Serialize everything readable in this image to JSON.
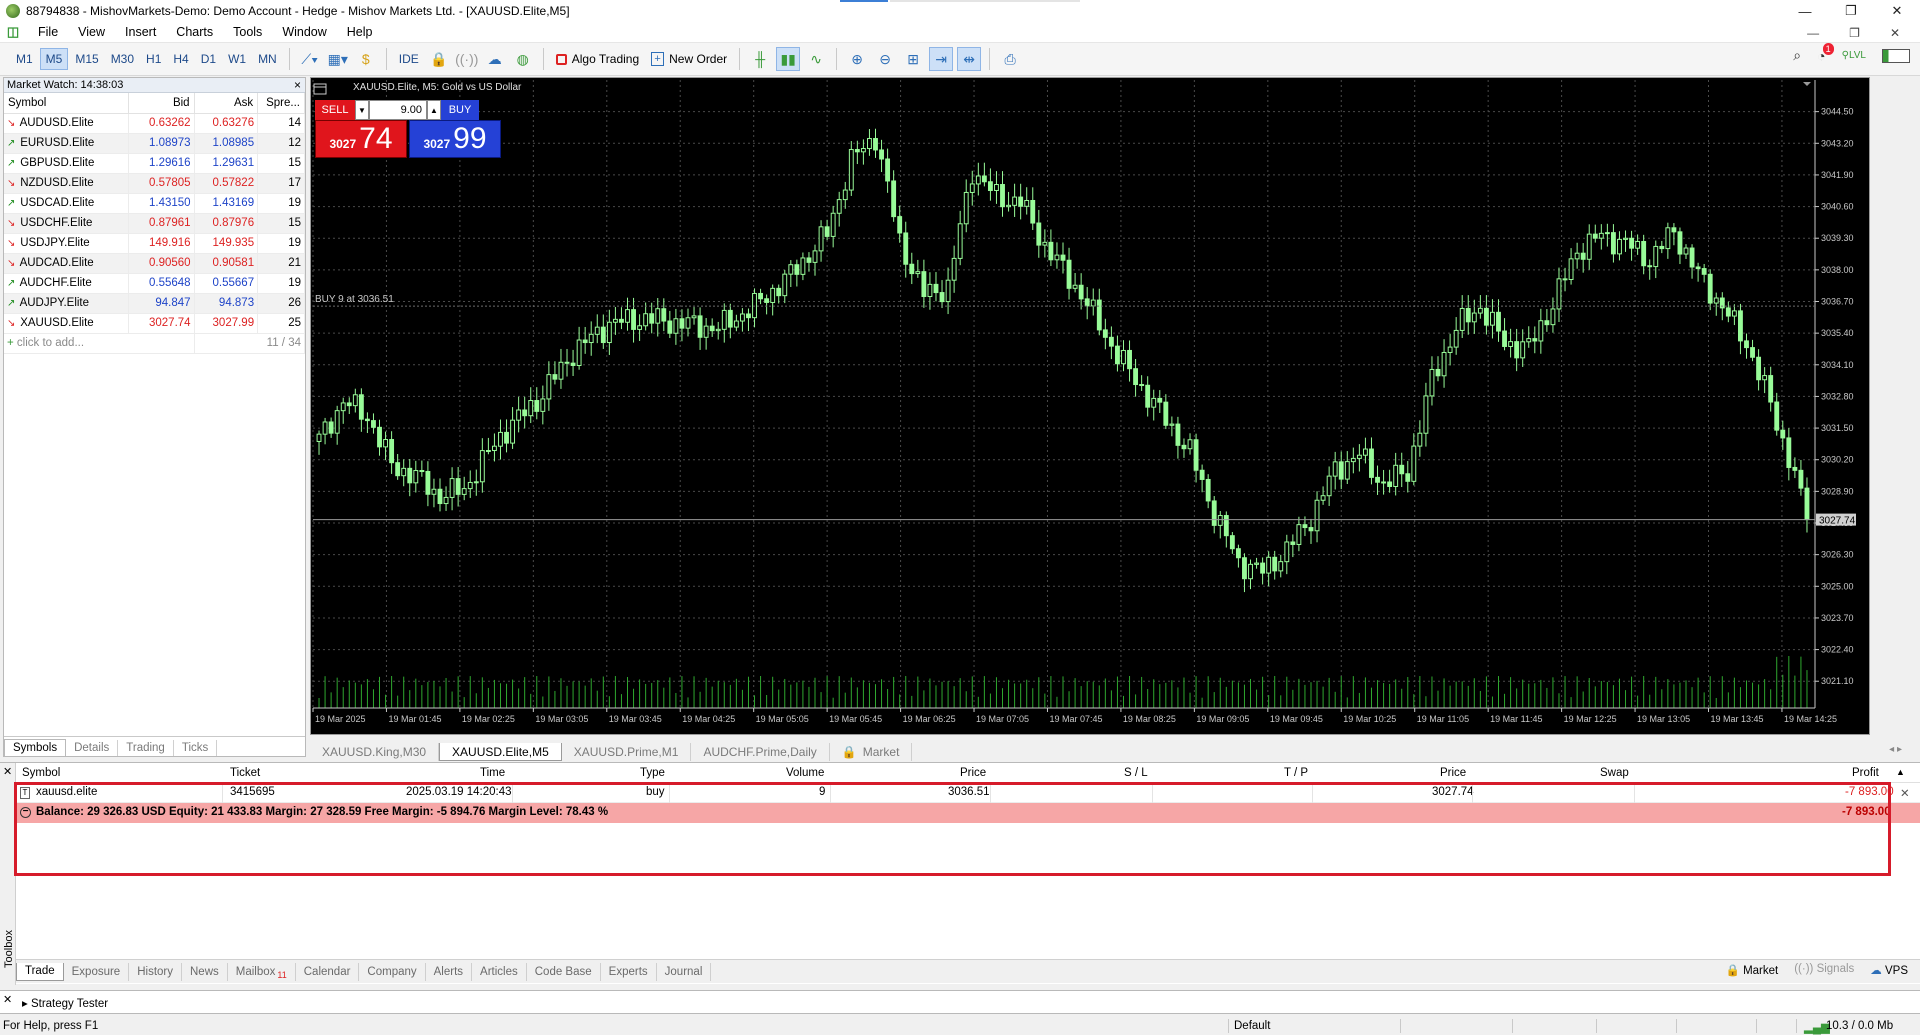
{
  "window": {
    "title": "88794838 - MishovMarkets-Demo: Demo Account - Hedge - Mishov Markets Ltd. - [XAUUSD.Elite,M5]"
  },
  "menu": [
    "File",
    "View",
    "Insert",
    "Charts",
    "Tools",
    "Window",
    "Help"
  ],
  "toolbar": {
    "timeframes": [
      "M1",
      "M5",
      "M15",
      "M30",
      "H1",
      "H4",
      "D1",
      "W1",
      "MN"
    ],
    "active_timeframe": "M5",
    "ide_label": "IDE",
    "algo_trading_label": "Algo Trading",
    "new_order_label": "New Order",
    "notification_count": "1",
    "lvl_label": "LVL"
  },
  "market_watch": {
    "title": "Market Watch: 14:38:03",
    "close": "×",
    "columns": [
      "Symbol",
      "Bid",
      "Ask",
      "Spre..."
    ],
    "rows": [
      {
        "symbol": "AUDUSD.Elite",
        "bid": "0.63262",
        "ask": "0.63276",
        "spread": "14",
        "dir": "down"
      },
      {
        "symbol": "EURUSD.Elite",
        "bid": "1.08973",
        "ask": "1.08985",
        "spread": "12",
        "dir": "up"
      },
      {
        "symbol": "GBPUSD.Elite",
        "bid": "1.29616",
        "ask": "1.29631",
        "spread": "15",
        "dir": "up"
      },
      {
        "symbol": "NZDUSD.Elite",
        "bid": "0.57805",
        "ask": "0.57822",
        "spread": "17",
        "dir": "down"
      },
      {
        "symbol": "USDCAD.Elite",
        "bid": "1.43150",
        "ask": "1.43169",
        "spread": "19",
        "dir": "up"
      },
      {
        "symbol": "USDCHF.Elite",
        "bid": "0.87961",
        "ask": "0.87976",
        "spread": "15",
        "dir": "down"
      },
      {
        "symbol": "USDJPY.Elite",
        "bid": "149.916",
        "ask": "149.935",
        "spread": "19",
        "dir": "down"
      },
      {
        "symbol": "AUDCAD.Elite",
        "bid": "0.90560",
        "ask": "0.90581",
        "spread": "21",
        "dir": "down"
      },
      {
        "symbol": "AUDCHF.Elite",
        "bid": "0.55648",
        "ask": "0.55667",
        "spread": "19",
        "dir": "up"
      },
      {
        "symbol": "AUDJPY.Elite",
        "bid": "94.847",
        "ask": "94.873",
        "spread": "26",
        "dir": "up"
      },
      {
        "symbol": "XAUUSD.Elite",
        "bid": "3027.74",
        "ask": "3027.99",
        "spread": "25",
        "dir": "down"
      }
    ],
    "add_label": "click to add...",
    "count": "11 / 34",
    "tabs": [
      "Symbols",
      "Details",
      "Trading",
      "Ticks"
    ],
    "active_tab": "Symbols"
  },
  "chart": {
    "header": "XAUUSD.Elite, M5:  Gold vs US Dollar",
    "sell_label": "SELL",
    "buy_label": "BUY",
    "volume": "9.00",
    "sell_price_small": "3027",
    "sell_price_big": "74",
    "buy_price_small": "3027",
    "buy_price_big": "99",
    "position_label": "BUY 9 at 3036.51",
    "current_price_label": "3027.74",
    "colors": {
      "bull": "#98fb98",
      "bear": "#98fb98",
      "grid": "#4a4a4a",
      "axis": "#c8c8c8"
    }
  },
  "chart_data": {
    "type": "candlestick",
    "ylim": [
      3020.0,
      3045.8
    ],
    "y_ticks": [
      "3044.50",
      "3043.20",
      "3041.90",
      "3040.60",
      "3039.30",
      "3038.00",
      "3036.70",
      "3035.40",
      "3034.10",
      "3032.80",
      "3031.50",
      "3030.20",
      "3028.90",
      "3027.60",
      "3026.30",
      "3025.00",
      "3023.70",
      "3022.40",
      "3021.10"
    ],
    "x_ticks": [
      "19 Mar 2025",
      "19 Mar 01:45",
      "19 Mar 02:25",
      "19 Mar 03:05",
      "19 Mar 03:45",
      "19 Mar 04:25",
      "19 Mar 05:05",
      "19 Mar 05:45",
      "19 Mar 06:25",
      "19 Mar 07:05",
      "19 Mar 07:45",
      "19 Mar 08:25",
      "19 Mar 09:05",
      "19 Mar 09:45",
      "19 Mar 10:25",
      "19 Mar 11:05",
      "19 Mar 11:45",
      "19 Mar 12:25",
      "19 Mar 13:05",
      "19 Mar 13:45",
      "19 Mar 14:25"
    ],
    "close_anchors": [
      [
        0,
        3031.0
      ],
      [
        4,
        3032.6
      ],
      [
        8,
        3032.0
      ],
      [
        12,
        3030.0
      ],
      [
        16,
        3029.5
      ],
      [
        20,
        3028.7
      ],
      [
        24,
        3029.0
      ],
      [
        30,
        3031.2
      ],
      [
        36,
        3032.6
      ],
      [
        42,
        3034.6
      ],
      [
        48,
        3035.8
      ],
      [
        54,
        3036.0
      ],
      [
        60,
        3035.8
      ],
      [
        66,
        3035.6
      ],
      [
        72,
        3036.5
      ],
      [
        78,
        3037.8
      ],
      [
        84,
        3039.5
      ],
      [
        88,
        3042.5
      ],
      [
        92,
        3043.5
      ],
      [
        96,
        3039.2
      ],
      [
        100,
        3037.0
      ],
      [
        104,
        3037.3
      ],
      [
        108,
        3042.1
      ],
      [
        112,
        3041.0
      ],
      [
        116,
        3040.8
      ],
      [
        120,
        3039.0
      ],
      [
        126,
        3037.0
      ],
      [
        132,
        3034.5
      ],
      [
        138,
        3032.5
      ],
      [
        144,
        3030.5
      ],
      [
        148,
        3028.0
      ],
      [
        152,
        3026.0
      ],
      [
        156,
        3025.6
      ],
      [
        160,
        3026.5
      ],
      [
        164,
        3027.8
      ],
      [
        168,
        3029.8
      ],
      [
        172,
        3030.4
      ],
      [
        176,
        3029.2
      ],
      [
        180,
        3029.7
      ],
      [
        184,
        3033.5
      ],
      [
        188,
        3035.6
      ],
      [
        192,
        3036.5
      ],
      [
        196,
        3035.0
      ],
      [
        200,
        3034.8
      ],
      [
        204,
        3036.6
      ],
      [
        208,
        3038.8
      ],
      [
        212,
        3039.4
      ],
      [
        216,
        3039.1
      ],
      [
        220,
        3038.4
      ],
      [
        224,
        3039.6
      ],
      [
        228,
        3037.8
      ],
      [
        232,
        3036.5
      ],
      [
        236,
        3035.0
      ],
      [
        240,
        3032.5
      ],
      [
        244,
        3029.5
      ],
      [
        246,
        3027.74
      ]
    ],
    "current_price": 3027.74,
    "position_open_price": 3036.51
  },
  "chart_tabs": {
    "items": [
      "XAUUSD.King,M30",
      "XAUUSD.Elite,M5",
      "XAUUSD.Prime,M1",
      "AUDCHF.Prime,Daily",
      "Market"
    ],
    "active": "XAUUSD.Elite,M5"
  },
  "trade": {
    "columns": {
      "symbol": "Symbol",
      "ticket": "Ticket",
      "time": "Time",
      "type": "Type",
      "volume": "Volume",
      "price": "Price",
      "sl": "S / L",
      "tp": "T / P",
      "price2": "Price",
      "swap": "Swap",
      "profit": "Profit"
    },
    "position": {
      "symbol": "xauusd.elite",
      "ticket": "3415695",
      "time": "2025.03.19 14:20:43",
      "type": "buy",
      "volume": "9",
      "price": "3036.51",
      "current_price": "3027.74",
      "profit": "-7 893.00"
    },
    "summary": {
      "text": "Balance: 29 326.83 USD  Equity: 21 433.83  Margin: 27 328.59  Free Margin: -5 894.76  Margin Level: 78.43 %",
      "profit": "-7 893.00"
    },
    "tabs": [
      "Trade",
      "Exposure",
      "History",
      "News",
      "Mailbox",
      "Calendar",
      "Company",
      "Alerts",
      "Articles",
      "Code Base",
      "Experts",
      "Journal"
    ],
    "mailbox_count": "11",
    "active_tab": "Trade",
    "right": {
      "market": "Market",
      "signals": "Signals",
      "vps": "VPS"
    },
    "toolbox_label": "Toolbox"
  },
  "tester": {
    "label": "Strategy Tester"
  },
  "status": {
    "help": "For Help, press F1",
    "profile": "Default",
    "traffic": "10.3 / 0.0 Mb"
  }
}
